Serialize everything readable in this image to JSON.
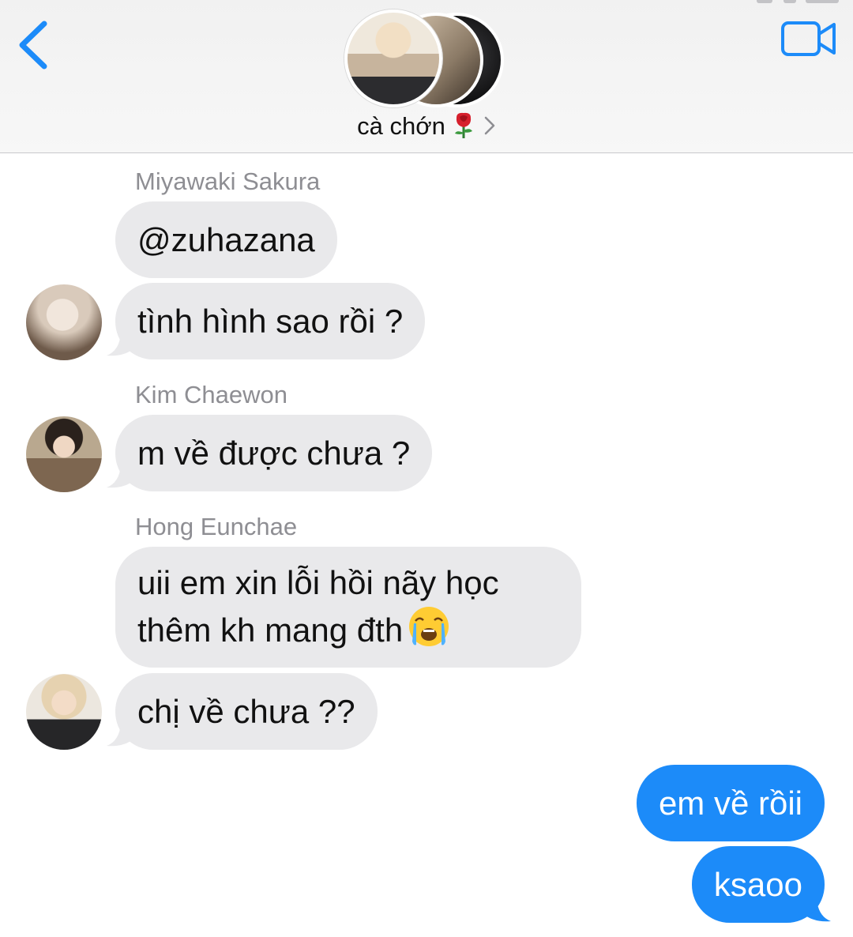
{
  "header": {
    "group_name": "cà chớn",
    "group_emoji": "rose",
    "accent_color": "#1c8bf9"
  },
  "messages": [
    {
      "sender": "Miyawaki Sakura",
      "text": "@zuhazana",
      "direction": "incoming"
    },
    {
      "sender": "Miyawaki Sakura",
      "text": "tình hình sao rồi ?",
      "direction": "incoming"
    },
    {
      "sender": "Kim Chaewon",
      "text": "m về được chưa ?",
      "direction": "incoming"
    },
    {
      "sender": "Hong Eunchae",
      "text_line1": "uii em xin lỗi hồi nãy học",
      "text_line2": "thêm kh mang đth",
      "emoji": "loudly-crying-face",
      "direction": "incoming"
    },
    {
      "sender": "Hong Eunchae",
      "text": "chị về chưa ??",
      "direction": "incoming"
    },
    {
      "sender": "me",
      "text": "em về rồii",
      "direction": "outgoing"
    },
    {
      "sender": "me",
      "text": "ksaoo",
      "direction": "outgoing"
    }
  ],
  "colors": {
    "incoming_bubble": "#e9e9eb",
    "outgoing_bubble": "#1c8bf9",
    "sender_name": "#8e8e93"
  }
}
